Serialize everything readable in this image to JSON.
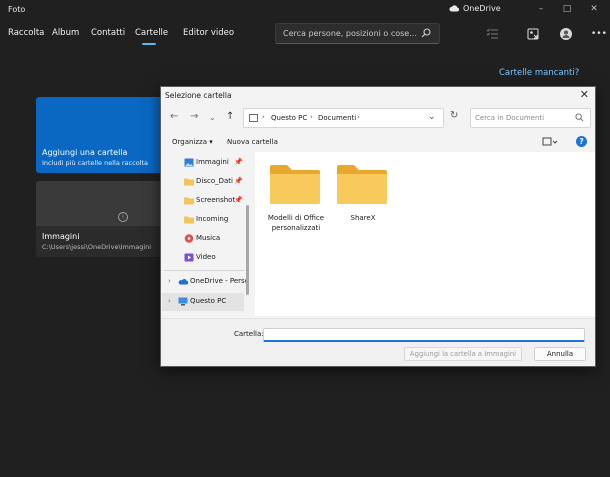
{
  "app": {
    "title": "Foto",
    "onedrive_label": "OneDrive"
  },
  "nav": {
    "tabs": [
      {
        "label": "Raccolta"
      },
      {
        "label": "Album"
      },
      {
        "label": "Contatti"
      },
      {
        "label": "Cartelle",
        "selected": true
      },
      {
        "label": "Editor video"
      }
    ],
    "search_placeholder": "Cerca persone, posizioni o cose...",
    "accent_color": "#5fb6f0"
  },
  "main": {
    "missing_folders_link": "Cartelle mancanti?",
    "add_card": {
      "title": "Aggiungi una cartella",
      "subtitle": "Includi più cartelle nella raccolta",
      "color": "#0a68c3"
    },
    "folder_card": {
      "title": "Immagini",
      "path": "C:\\Users\\jessi\\OneDrive\\Immagini"
    }
  },
  "dialog": {
    "title": "Selezione cartella",
    "breadcrumb": [
      "Questo PC",
      "Documenti"
    ],
    "search_placeholder": "Cerca in Documenti",
    "toolbar": {
      "organize": "Organizza",
      "new_folder": "Nuova cartella"
    },
    "nav_pane": {
      "quick_access": [
        {
          "label": "Immagini",
          "icon": "images-icon",
          "pinned": true
        },
        {
          "label": "Disco_Dati",
          "icon": "folder-icon",
          "pinned": true
        },
        {
          "label": "Screenshot",
          "icon": "folder-icon",
          "pinned": true
        },
        {
          "label": "Incoming",
          "icon": "folder-icon",
          "pinned": false
        },
        {
          "label": "Musica",
          "icon": "music-icon",
          "pinned": false
        },
        {
          "label": "Video",
          "icon": "video-icon",
          "pinned": false
        }
      ],
      "roots": [
        {
          "label": "OneDrive - Perso",
          "icon": "onedrive-icon"
        },
        {
          "label": "Questo PC",
          "icon": "computer-icon",
          "selected": true
        }
      ]
    },
    "folders": [
      {
        "label": "Modelli di Office personalizzati"
      },
      {
        "label": "ShareX"
      }
    ],
    "footer": {
      "folder_label": "Cartella:",
      "folder_value": "",
      "add_button": "Aggiungi la cartella a Immagini",
      "cancel_button": "Annulla"
    }
  }
}
